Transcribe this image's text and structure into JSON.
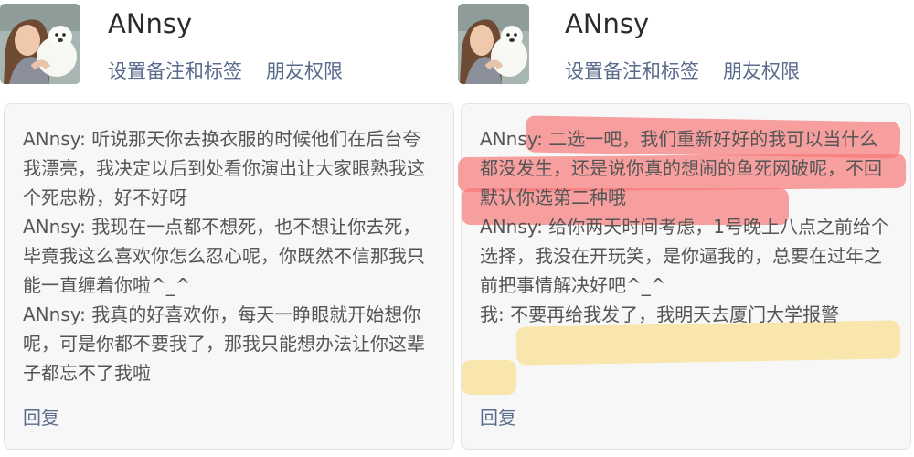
{
  "colors": {
    "name_text": "#2b2b2b",
    "link_blue": "#5b6b8c",
    "message_text": "#555555",
    "card_bg": "#f7f7f7",
    "highlight_red": "#f67878",
    "highlight_yellow": "#fade8c"
  },
  "left": {
    "profile": {
      "name": "ANnsy",
      "action_remark": "设置备注和标签",
      "action_permission": "朋友权限"
    },
    "messages": [
      "ANnsy: 听说那天你去换衣服的时候他们在后台夸我漂亮，我决定以后到处看你演出让大家眼熟我这个死忠粉，好不好呀",
      "ANnsy: 我现在一点都不想死，也不想让你去死，毕竟我这么喜欢你怎么忍心呢，你既然不信那我只能一直缠着你啦^_^",
      "ANnsy: 我真的好喜欢你，每天一睁眼就开始想你呢，可是你都不要我了，那我只能想办法让你这辈子都忘不了我啦"
    ],
    "reply": "回复"
  },
  "right": {
    "profile": {
      "name": "ANnsy",
      "action_remark": "设置备注和标签",
      "action_permission": "朋友权限"
    },
    "messages": [
      "ANnsy: 二选一吧，我们重新好好的我可以当什么都没发生，还是说你真的想闹的鱼死网破呢，不回默认你选第二种哦",
      "ANnsy: 给你两天时间考虑，1号晚上八点之前给个选择，我没在开玩笑，是你逼我的，总要在过年之前把事情解决好吧^_^",
      "我: 不要再给我发了，我明天去厦门大学报警"
    ],
    "reply": "回复"
  }
}
